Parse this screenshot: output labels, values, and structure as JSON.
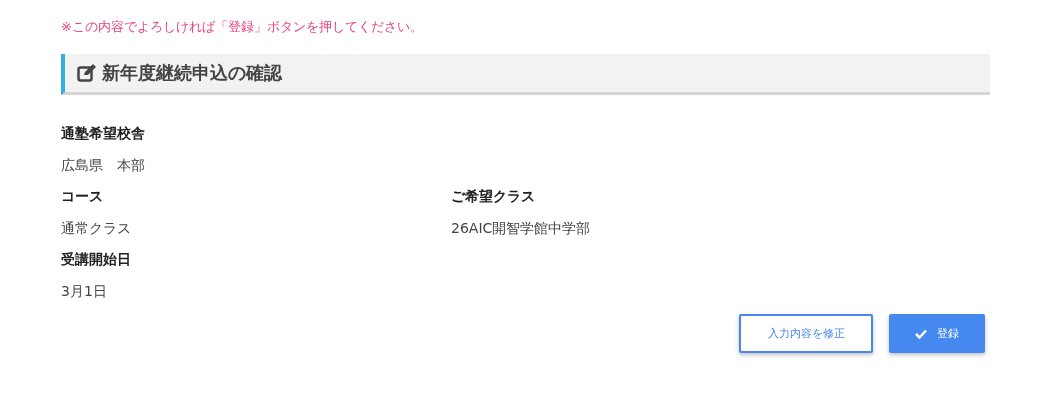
{
  "notice": "※この内容でよろしければ「登録」ボタンを押してください。",
  "heading": {
    "title": "新年度継続申込の確認"
  },
  "rows": [
    {
      "fields": [
        {
          "label": "通塾希望校舎",
          "value": "広島県　本部"
        }
      ]
    },
    {
      "fields": [
        {
          "label": "コース",
          "value": "通常クラス"
        },
        {
          "label": "ご希望クラス",
          "value": "26AIC開智学館中学部"
        }
      ]
    },
    {
      "fields": [
        {
          "label": "受講開始日",
          "value": "3月1日"
        }
      ]
    }
  ],
  "buttons": [
    {
      "kind": "secondary",
      "label": "入力内容を修正"
    },
    {
      "kind": "primary",
      "label": "登録"
    }
  ]
}
